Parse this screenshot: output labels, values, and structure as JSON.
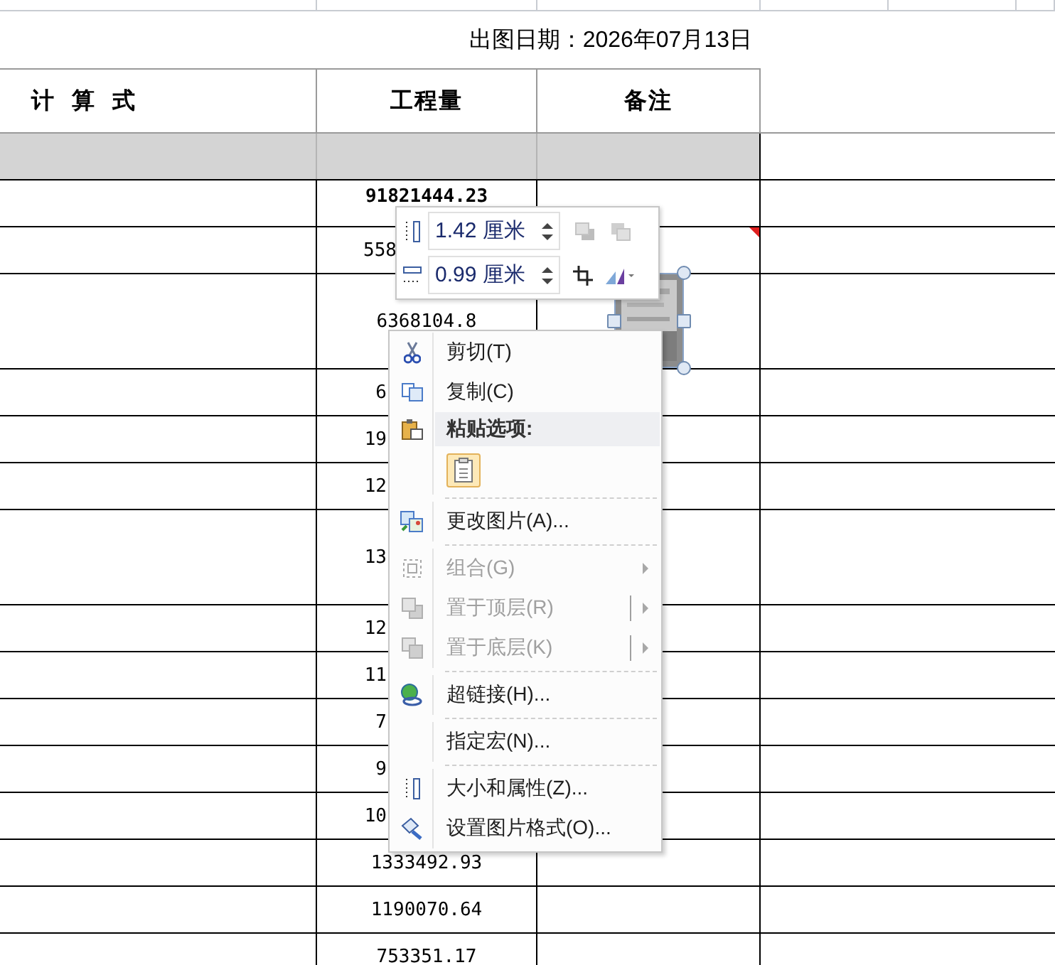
{
  "sheet": {
    "print_date": "出图日期：2026年07月13日",
    "columns": [
      "计 算 式",
      "工程量",
      "备注"
    ],
    "rows": [
      {
        "quantity": "91821444.23",
        "bold": true,
        "tall": false,
        "comment": false
      },
      {
        "quantity": "558",
        "bold": false,
        "tall": false,
        "comment": true
      },
      {
        "quantity": "6368104.8",
        "bold": false,
        "tall": true,
        "comment": false
      },
      {
        "quantity": "6",
        "bold": false,
        "tall": false,
        "comment": false
      },
      {
        "quantity": "19",
        "bold": false,
        "tall": false,
        "comment": false
      },
      {
        "quantity": "12",
        "bold": false,
        "tall": false,
        "comment": false
      },
      {
        "quantity": "13",
        "bold": false,
        "tall": true,
        "comment": false
      },
      {
        "quantity": "12",
        "bold": false,
        "tall": false,
        "comment": false
      },
      {
        "quantity": "11",
        "bold": false,
        "tall": false,
        "comment": false
      },
      {
        "quantity": "7",
        "bold": false,
        "tall": false,
        "comment": false
      },
      {
        "quantity": "9",
        "bold": false,
        "tall": false,
        "comment": false
      },
      {
        "quantity": "10",
        "bold": false,
        "tall": false,
        "comment": false
      },
      {
        "quantity": "1333492.93",
        "bold": false,
        "tall": false,
        "comment": false
      },
      {
        "quantity": "1190070.64",
        "bold": false,
        "tall": false,
        "comment": false
      },
      {
        "quantity": "753351.17",
        "bold": false,
        "tall": false,
        "comment": false
      }
    ]
  },
  "picture": {
    "selected": true
  },
  "mini_toolbar": {
    "height": {
      "value": "1.42 厘米"
    },
    "width": {
      "value": "0.99 厘米"
    }
  },
  "context_menu": [
    {
      "kind": "command",
      "text": "剪切(T)",
      "disabled": false,
      "submenu": false,
      "split": false
    },
    {
      "kind": "command",
      "text": "复制(C)",
      "disabled": false,
      "submenu": false,
      "split": false
    },
    {
      "kind": "header",
      "text": "粘贴选项:"
    },
    {
      "kind": "paste_options"
    },
    {
      "kind": "separator"
    },
    {
      "kind": "command",
      "text": "更改图片(A)...",
      "disabled": false,
      "submenu": false,
      "split": false
    },
    {
      "kind": "separator"
    },
    {
      "kind": "command",
      "text": "组合(G)",
      "disabled": true,
      "submenu": true,
      "split": false
    },
    {
      "kind": "command",
      "text": "置于顶层(R)",
      "disabled": true,
      "submenu": true,
      "split": true
    },
    {
      "kind": "command",
      "text": "置于底层(K)",
      "disabled": true,
      "submenu": true,
      "split": true
    },
    {
      "kind": "separator"
    },
    {
      "kind": "command",
      "text": "超链接(H)...",
      "disabled": false,
      "submenu": false,
      "split": false
    },
    {
      "kind": "separator"
    },
    {
      "kind": "command",
      "text": "指定宏(N)...",
      "disabled": false,
      "submenu": false,
      "split": false
    },
    {
      "kind": "separator"
    },
    {
      "kind": "command",
      "text": "大小和属性(Z)...",
      "disabled": false,
      "submenu": false,
      "split": false
    },
    {
      "kind": "command",
      "text": "设置图片格式(O)...",
      "disabled": false,
      "submenu": false,
      "split": false
    }
  ]
}
